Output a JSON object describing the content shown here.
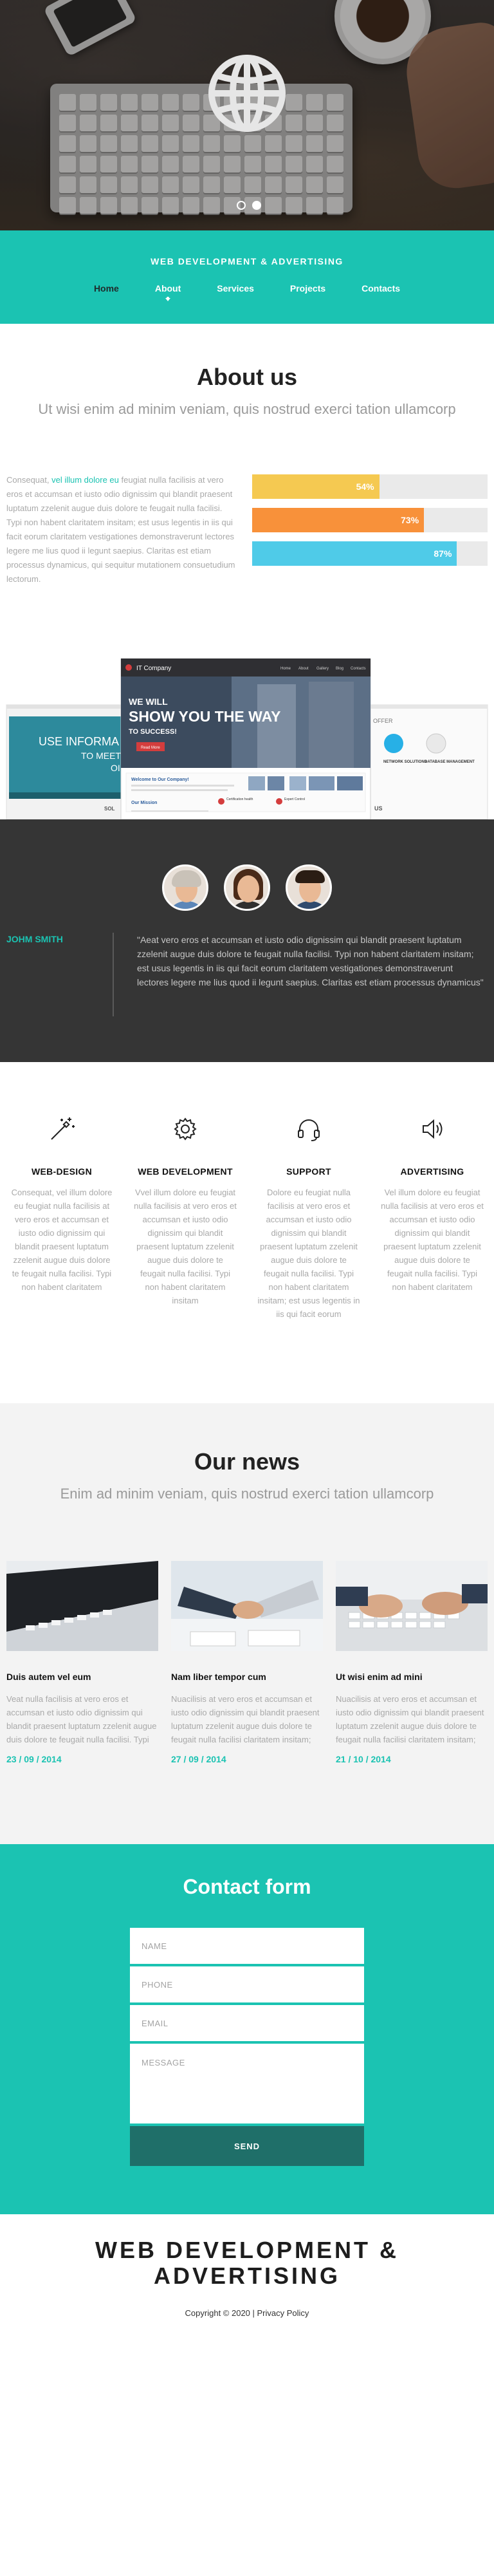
{
  "hero": {
    "slider_dots": [
      {
        "active": false
      },
      {
        "active": true
      }
    ]
  },
  "header": {
    "brand": "WEB DEVELOPMENT & ADVERTISING",
    "nav": [
      {
        "label": "Home",
        "key": "home"
      },
      {
        "label": "About",
        "key": "about"
      },
      {
        "label": "Services",
        "key": "services"
      },
      {
        "label": "Projects",
        "key": "projects"
      },
      {
        "label": "Contacts",
        "key": "contacts"
      }
    ],
    "active_nav": "about"
  },
  "about": {
    "title": "About us",
    "subtitle": "Ut wisi enim ad minim veniam, quis nostrud exerci tation ullamcorp",
    "text_before": "Consequat, ",
    "text_highlight": "vel illum dolore eu",
    "text_after": " feugiat nulla facilisis at vero eros et accumsan et iusto odio dignissim qui blandit praesent luptatum zzelenit augue duis dolore te feugait nulla facilisi. Typi non habent claritatem insitam; est usus legentis in iis qui facit eorum claritatem vestigationes demonstraverunt lectores legere me lius quod ii legunt saepius. Claritas est etiam processus dynamicus, qui sequitur mutationem consuetudium lectorum.",
    "skills": [
      {
        "percent": 54,
        "label": "54%",
        "color": "#f5c951"
      },
      {
        "percent": 73,
        "label": "73%",
        "color": "#f8913a"
      },
      {
        "percent": 87,
        "label": "87%",
        "color": "#4fcbe8"
      }
    ]
  },
  "mockup": {
    "left_screen": {
      "heading": "USE INFORMA",
      "line2": "TO MEET",
      "line3": "OI"
    },
    "center_screen": {
      "company": "IT Company",
      "nav": [
        "Home",
        "About",
        "Gallery",
        "Blog",
        "Contacts"
      ],
      "hero_line1": "WE WILL",
      "hero_line2": "SHOW YOU THE WAY",
      "hero_line3": "TO SUCCESS!",
      "hero_button": "Read More",
      "welcome": "Welcome to Our Company!",
      "mission": "Our Mission",
      "col1": "Certification health",
      "col2": "Expert Control"
    },
    "right_screen": {
      "offer": "OFFER",
      "item1": "NETWORK SOLUTIONS",
      "item2": "DATABASE MANAGEMENT",
      "us": "US"
    }
  },
  "testimonial": {
    "name": "JOHM SMITH",
    "quote": "\"Aeat vero eros et accumsan et iusto odio dignissim qui blandit praesent luptatum zzelenit augue duis dolore te feugait nulla facilisi. Typi non habent claritatem insitam; est usus legentis in iis qui facit eorum claritatem vestigationes demonstraverunt lectores legere me lius quod ii legunt saepius. Claritas est etiam processus dynamicus\"",
    "avatars": [
      {
        "name": "man-avatar",
        "hair": "#c9c2b8",
        "shirt": "#5c86b8"
      },
      {
        "name": "woman-avatar",
        "hair": "#4a2a18",
        "shirt": "#2f2f2f"
      },
      {
        "name": "young-man-avatar",
        "hair": "#2a1d14",
        "shirt": "#2f4a6e"
      }
    ]
  },
  "services": [
    {
      "icon": "magic-wand-icon",
      "title": "WEB-DESIGN",
      "text": "Consequat, vel illum dolore eu feugiat nulla facilisis at vero eros et accumsan et iusto odio dignissim qui blandit praesent luptatum zzelenit augue duis dolore te feugait nulla facilisi. Typi non habent claritatem"
    },
    {
      "icon": "gear-icon",
      "title": "WEB DEVELOPMENT",
      "text": "Vvel illum dolore eu feugiat nulla facilisis at vero eros et accumsan et iusto odio dignissim qui blandit praesent luptatum zzelenit augue duis dolore te feugait nulla facilisi. Typi non habent claritatem insitam"
    },
    {
      "icon": "headset-icon",
      "title": "SUPPORT",
      "text": "Dolore eu feugiat nulla facilisis at vero eros et accumsan et iusto odio dignissim qui blandit praesent luptatum zzelenit augue duis dolore te feugait nulla facilisi. Typi non habent claritatem insitam; est usus legentis in iis qui facit eorum"
    },
    {
      "icon": "speaker-icon",
      "title": "ADVERTISING",
      "text": "Vel illum dolore eu feugiat nulla facilisis at vero eros et accumsan et iusto odio dignissim qui blandit praesent luptatum zzelenit augue duis dolore te feugait nulla facilisi. Typi non habent claritatem"
    }
  ],
  "news": {
    "title": "Our news",
    "subtitle": "Enim ad minim veniam, quis nostrud exerci tation ullamcorp",
    "items": [
      {
        "title": "Duis autem vel eum",
        "text": "Veat nulla facilisis at vero eros et accumsan et iusto odio dignissim qui blandit praesent luptatum zzelenit augue duis dolore te feugait nulla facilisi. Typi non",
        "date": "23 / 09 / 2014",
        "image": "laptop-keyboard"
      },
      {
        "title": "Nam liber tempor cum",
        "text": "Nuacilisis at vero eros et accumsan et iusto odio dignissim qui blandit praesent luptatum zzelenit augue duis dolore te feugait nulla facilisi claritatem insitam; est",
        "date": "27 / 09 / 2014",
        "image": "handshake"
      },
      {
        "title": "Ut wisi enim ad mini",
        "text": "Nuacilisis at vero eros et accumsan et iusto odio dignissim qui blandit praesent luptatum zzelenit augue duis dolore te feugait nulla facilisi claritatem insitam; est",
        "date": "21 / 10 / 2014",
        "image": "hands-typing"
      }
    ]
  },
  "contact": {
    "title": "Contact form",
    "name_placeholder": "NAME",
    "phone_placeholder": "PHONE",
    "email_placeholder": "EMAIL",
    "message_placeholder": "MESSAGE",
    "send_label": "SEND"
  },
  "footer": {
    "brand_line1": "WEB DEVELOPMENT &",
    "brand_line2": "ADVERTISING",
    "copyright": "Copyright © 2020 | ",
    "privacy": "Privacy Policy"
  },
  "colors": {
    "accent": "#1bc3b2",
    "dark": "#353535",
    "send_button": "#1f6f69"
  }
}
